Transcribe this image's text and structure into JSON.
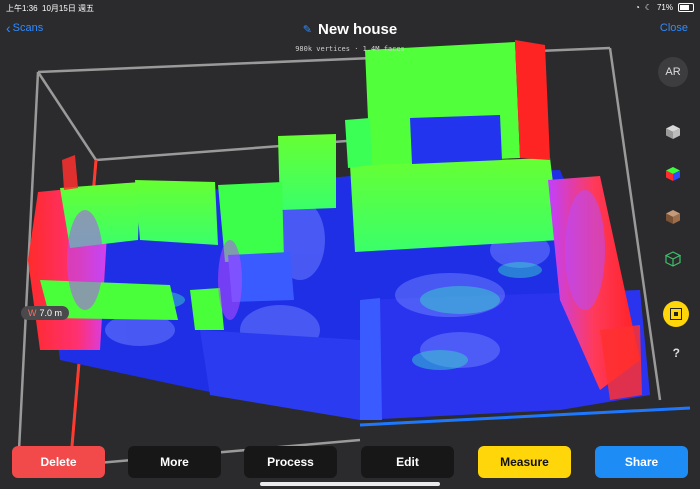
{
  "status": {
    "time": "上午1:36",
    "date": "10月15日 週五",
    "battery": "71%",
    "battery_level": 0.71
  },
  "nav": {
    "back_label": "Scans",
    "title": "New house",
    "close_label": "Close"
  },
  "meta_text": "980k vertices · 1.4M faces",
  "side_tools": {
    "ar_label": "AR",
    "help_label": "?",
    "icons": [
      "cube-gray-icon",
      "cube-color-icon",
      "cube-texture-icon",
      "wireframe-cube-icon",
      "measure-tool-icon",
      "help-icon"
    ]
  },
  "measurement": {
    "axis": "W",
    "value": "7.0 m"
  },
  "toolbar": {
    "delete": "Delete",
    "more": "More",
    "process": "Process",
    "edit": "Edit",
    "measure": "Measure",
    "share": "Share"
  },
  "colors": {
    "accent": "#2f8bff",
    "delete": "#f24a4a",
    "measure": "#ffd60a",
    "share": "#1e8cf5",
    "dark_button": "#171717",
    "background": "#2b2b2d"
  }
}
